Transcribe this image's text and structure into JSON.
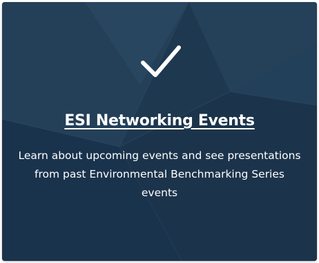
{
  "card": {
    "icon": "checkmark-icon",
    "title": "ESI Networking Events",
    "description": "Learn about upcoming events and see presentations from past Environmental Benchmarking Series events",
    "colors": {
      "background": "#1e3850",
      "text": "#ffffff"
    }
  }
}
